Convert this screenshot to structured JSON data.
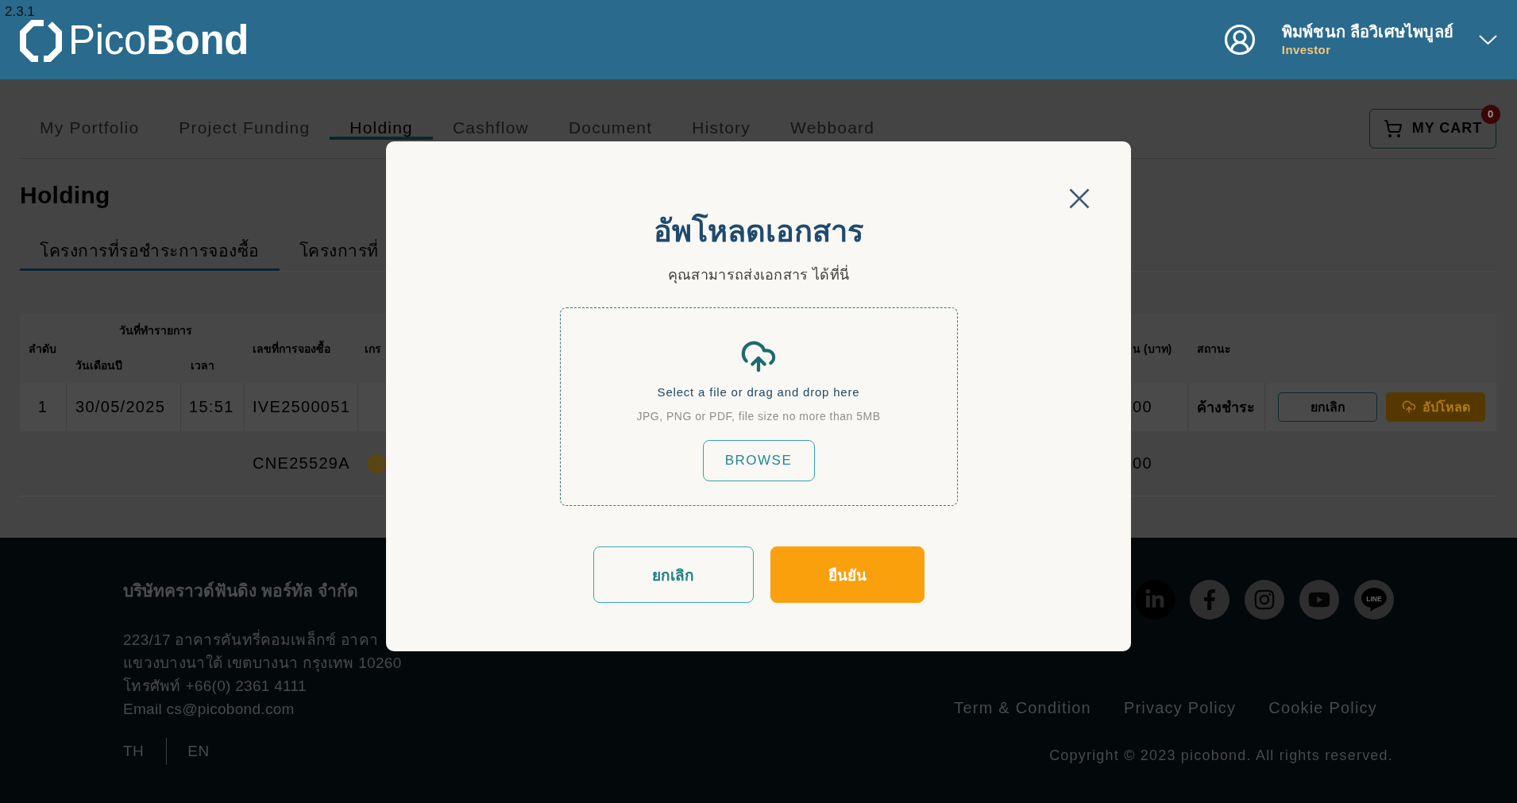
{
  "version_label": "2.3.1",
  "header": {
    "logo_text": "Pico**Bond**",
    "user": {
      "name": "พิมพ์ชนก ลือวิเศษไพบูลย์",
      "role": "Investor"
    }
  },
  "nav_tabs": [
    {
      "label": "My Portfolio",
      "selected": false
    },
    {
      "label": "Project Funding",
      "selected": false
    },
    {
      "label": "Holding",
      "selected": true
    },
    {
      "label": "Cashflow",
      "selected": false
    },
    {
      "label": "Document",
      "selected": false
    },
    {
      "label": "History",
      "selected": false
    },
    {
      "label": "Webboard",
      "selected": false
    }
  ],
  "cart": {
    "label": "MY CART",
    "count": "0"
  },
  "page_title": "Holding",
  "sub_tabs": [
    {
      "label": "โครงการที่รอชำระการจองซื้อ",
      "selected": true
    },
    {
      "label": "โครงการที่",
      "selected": false
    }
  ],
  "table": {
    "columns": [
      {
        "label": "ลำดับ"
      },
      {
        "label": "วันที่ทำรายการ",
        "children": [
          {
            "label": "วันเดือนปี"
          },
          {
            "label": "เวลา"
          }
        ]
      },
      {
        "label": "เลขที่การจองซื้อ"
      },
      {
        "label": "เกร"
      },
      {
        "label": "น (บาท)"
      },
      {
        "label": "สถานะ"
      }
    ],
    "rows": [
      {
        "kind": "booking",
        "no": "1",
        "date": "30/05/2025",
        "time": "15:51",
        "booking_no": "IVE2500051",
        "amount": "00",
        "status": "ค้างชำระ",
        "actions": [
          {
            "label": "ยกเลิก",
            "kind": "outline"
          },
          {
            "label": "อัปโหลด",
            "kind": "upload"
          }
        ]
      },
      {
        "kind": "item",
        "booking_no": "CNE25529A",
        "amount": "00"
      }
    ]
  },
  "upload_dialog": {
    "title": "อัพโหลดเอกสาร",
    "subtitle": "คุณสามารถส่งเอกสาร ได้ที่นี่",
    "dropzone": {
      "prompt": "Select a file or drag and drop here",
      "hint": "JPG, PNG or PDF, file size no more than 5MB",
      "browse_button": "BROWSE"
    },
    "buttons": [
      {
        "label": "ยกเลิก",
        "kind": "secondary"
      },
      {
        "label": "ยืนยัน",
        "kind": "primary"
      }
    ]
  },
  "footer": {
    "company": "บริษัทคราวด์ฟันดิง พอร์ทัล จำกัด",
    "address_lines": [
      "223/17 อาคารคันทรี่คอมเพล็กซ์ อาคา",
      "แขวงบางนาใต้ เขตบางนา กรุงเทพ 10260",
      "โทรศัพท์ +66(0) 2361 4111",
      "Email cs@picobond.com"
    ],
    "languages": [
      "TH",
      "EN"
    ],
    "social": [
      {
        "kind": "linkedin",
        "hovered": true
      },
      {
        "kind": "facebook",
        "hovered": false
      },
      {
        "kind": "instagram",
        "hovered": false
      },
      {
        "kind": "youtube",
        "hovered": false
      },
      {
        "kind": "line",
        "label": "LINE",
        "hovered": false
      }
    ],
    "links": [
      "Term & Condition",
      "Privacy Policy",
      "Cookie Policy"
    ],
    "copyright": "Copyright © 2023 picobond. All rights reserved."
  }
}
